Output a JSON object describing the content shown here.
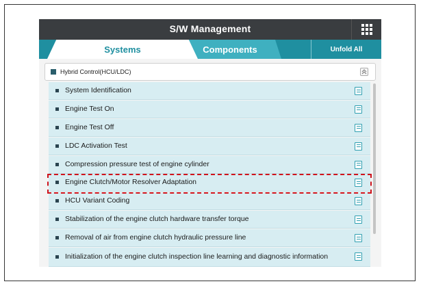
{
  "header": {
    "title": "S/W Management",
    "grid_icon": "grid-icon"
  },
  "tabs": [
    {
      "label": "Systems",
      "active": true
    },
    {
      "label": "Components",
      "active": false
    }
  ],
  "unfold_label": "Unfold All",
  "group": {
    "label": "Hybrid Control(HCU/LDC)",
    "collapse_icon": "collapse-icon"
  },
  "items": [
    {
      "label": "System Identification"
    },
    {
      "label": "Engine Test On"
    },
    {
      "label": "Engine Test Off"
    },
    {
      "label": "LDC Activation Test"
    },
    {
      "label": "Compression pressure test of engine cylinder"
    },
    {
      "label": "Engine Clutch/Motor Resolver Adaptation",
      "highlighted": true
    },
    {
      "label": "HCU Variant Coding"
    },
    {
      "label": "Stabilization of the engine clutch hardware transfer torque"
    },
    {
      "label": "Removal of air from engine clutch hydraulic pressure line"
    },
    {
      "label": "Initialization of the engine clutch inspection line learning and diagnostic information"
    }
  ],
  "colors": {
    "accent": "#1f8fa0",
    "row_bg": "#d7edf2",
    "highlight": "#d0121b"
  }
}
